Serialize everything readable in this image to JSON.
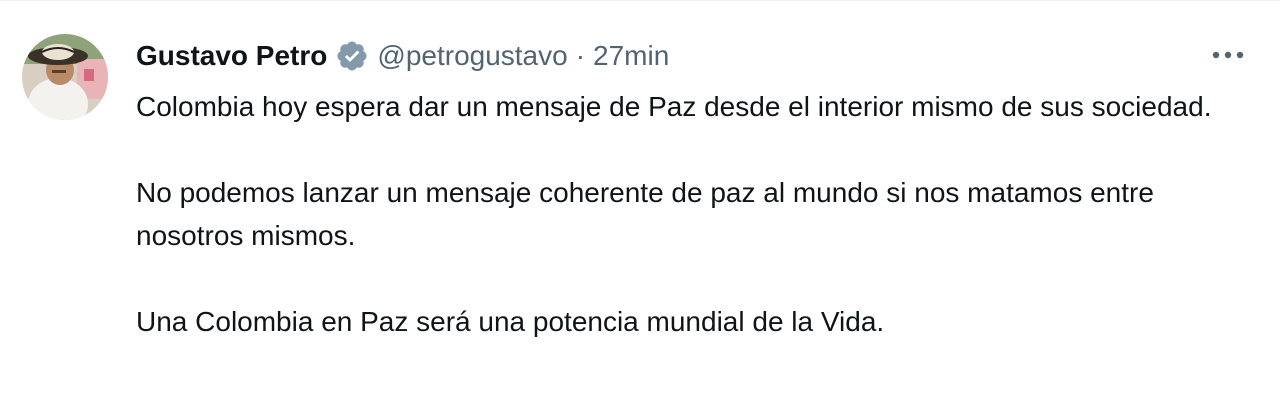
{
  "tweet": {
    "author": {
      "display_name": "Gustavo Petro",
      "handle": "@petrogustavo",
      "verified_icon": "verified-badge-icon",
      "verified_color": "#829aab"
    },
    "separator": "·",
    "timestamp": "27min",
    "more_icon": "more-options-icon",
    "paragraphs": [
      "Colombia hoy espera dar un mensaje de Paz desde el interior mismo de sus sociedad.",
      "No podemos lanzar un mensaje coherente de paz al mundo si nos matamos entre nosotros mismos.",
      "Una Colombia en Paz será una potencia mundial de la Vida."
    ]
  },
  "colors": {
    "text_primary": "#0f1419",
    "text_secondary": "#536471",
    "border": "#eff3f4"
  }
}
